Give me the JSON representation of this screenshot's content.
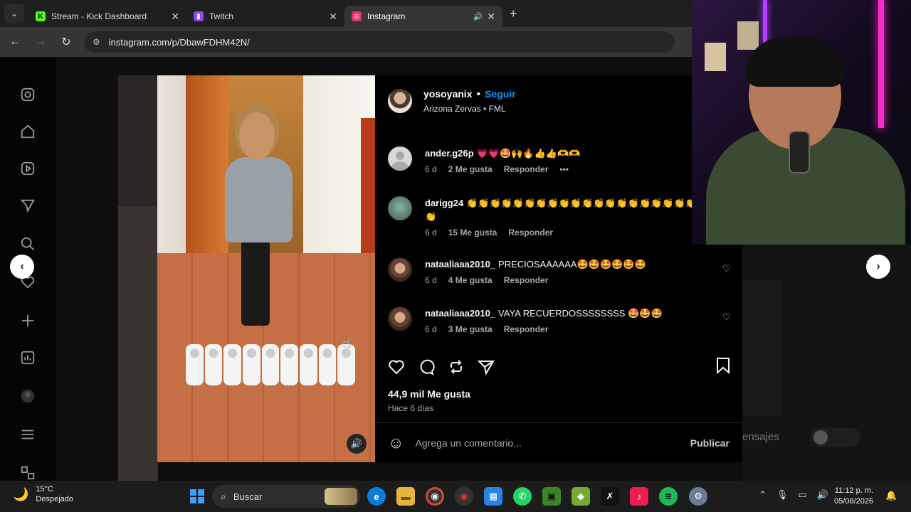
{
  "tabs": [
    {
      "title": "Stream - Kick Dashboard",
      "icon": "kick-icon",
      "color": "#53fc18",
      "glyph": "K"
    },
    {
      "title": "Twitch",
      "icon": "twitch-icon",
      "color": "#9146ff",
      "glyph": "▮"
    },
    {
      "title": "Instagram",
      "icon": "instagram-icon",
      "color": "#e1306c",
      "glyph": "◎",
      "active": true
    }
  ],
  "address": {
    "url": "instagram.com/p/DbawFDHM42N/"
  },
  "post": {
    "username": "yosoyanix",
    "follow_label": "Seguir",
    "audio": "Arizona Zervas • FML",
    "likes": "44,9 mil Me gusta",
    "ago": "Hace 6 días",
    "comment_placeholder": "Agrega un comentario...",
    "publish_label": "Publicar"
  },
  "comments": [
    {
      "user": "ander.g26p",
      "text": "💗💗🤩🙌🔥👍👍🫶🫶",
      "time": "6 d",
      "likes": "2 Me gusta",
      "reply": "Responder",
      "more": "•••"
    },
    {
      "user": "darigg24",
      "text": "👏👏👏👏👏👏👏👏👏👏👏👏👏👏👏👏👏👏👏👏👏👏👏",
      "time": "6 d",
      "likes": "15 Me gusta",
      "reply": "Responder"
    },
    {
      "user": "nataaliaaa2010_",
      "text": "PRECIOSAAAAAA🤩🤩🤩🤩🤩🤩",
      "time": "6 d",
      "likes": "4 Me gusta",
      "reply": "Responder"
    },
    {
      "user": "nataaliaaa2010_",
      "text": "VAYA RECUERDOSSSSSSSS 🤩🤩🤩",
      "time": "6 d",
      "likes": "3 Me gusta",
      "reply": "Responder"
    }
  ],
  "background": {
    "messages_fragment": "ensajes"
  },
  "taskbar": {
    "temp": "15°C",
    "condition": "Despejado",
    "search": "Buscar",
    "time": "11:12 p. m.",
    "date": "05/08/2026"
  },
  "colors": {
    "accent": "#0095f6",
    "bg": "#000000"
  }
}
